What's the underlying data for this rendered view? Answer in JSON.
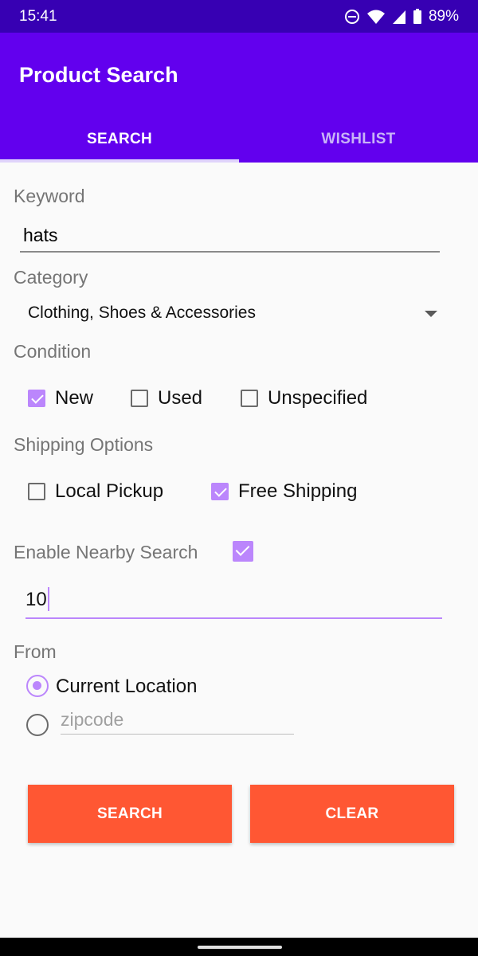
{
  "status": {
    "time": "15:41",
    "battery": "89%"
  },
  "app": {
    "title": "Product Search"
  },
  "tabs": [
    {
      "label": "SEARCH"
    },
    {
      "label": "WISHLIST"
    }
  ],
  "keyword": {
    "label": "Keyword",
    "value": "hats"
  },
  "category": {
    "label": "Category",
    "selected": "Clothing, Shoes & Accessories"
  },
  "condition": {
    "label": "Condition",
    "options": [
      {
        "label": "New",
        "checked": true
      },
      {
        "label": "Used",
        "checked": false
      },
      {
        "label": "Unspecified",
        "checked": false
      }
    ]
  },
  "shipping": {
    "label": "Shipping Options",
    "options": [
      {
        "label": "Local Pickup",
        "checked": false
      },
      {
        "label": "Free Shipping",
        "checked": true
      }
    ]
  },
  "nearby": {
    "label": "Enable Nearby Search",
    "enabled": true,
    "distance": "10"
  },
  "from": {
    "label": "From",
    "current_location_label": "Current Location",
    "zipcode_placeholder": "zipcode",
    "selected": "current"
  },
  "buttons": {
    "search": "SEARCH",
    "clear": "CLEAR"
  },
  "colors": {
    "status_bar": "#3700b3",
    "app_bar": "#6200ee",
    "accent": "#bb86fc",
    "button": "#ff5733"
  }
}
